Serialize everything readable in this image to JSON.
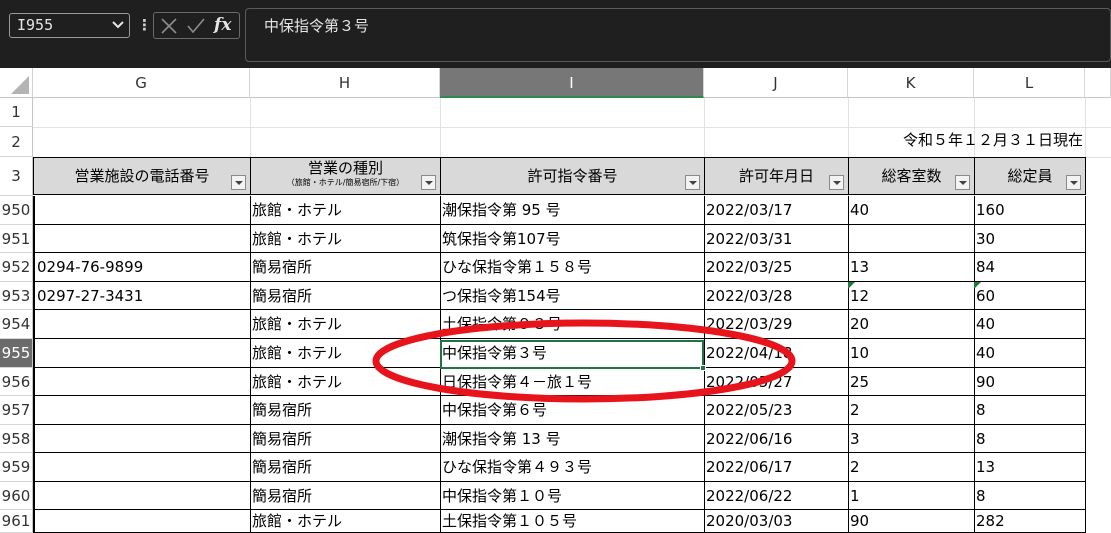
{
  "formula_bar": {
    "name_box": "I955",
    "fx_label": "fx",
    "formula": "中保指令第３号"
  },
  "columns": [
    "G",
    "H",
    "I",
    "J",
    "K",
    "L"
  ],
  "row_numbers": [
    "1",
    "2",
    "3",
    "950",
    "951",
    "952",
    "953",
    "954",
    "955",
    "956",
    "957",
    "958",
    "959",
    "960",
    "961"
  ],
  "date_note": "令和５年１２月３１日現在",
  "headers": {
    "phone": "営業施設の電話番号",
    "type": "営業の種別",
    "type_sub": "（旅館・ホテル/簡易宿所/下宿）",
    "permit_no": "許可指令番号",
    "permit_date": "許可年月日",
    "rooms": "総客室数",
    "capacity": "総定員"
  },
  "rows": [
    {
      "phone": "",
      "type": "旅館・ホテル",
      "permit": "潮保指令第 95 号",
      "date": "2022/03/17",
      "rooms": "40",
      "cap": "160"
    },
    {
      "phone": "",
      "type": "旅館・ホテル",
      "permit": "筑保指令第107号",
      "date": "2022/03/31",
      "rooms": "",
      "cap": "30"
    },
    {
      "phone": "0294-76-9899",
      "type": "簡易宿所",
      "permit": "ひな保指令第１５８号",
      "date": "2022/03/25",
      "rooms": "13",
      "cap": "84"
    },
    {
      "phone": "0297-27-3431",
      "type": "簡易宿所",
      "permit": "つ保指令第154号",
      "date": "2022/03/28",
      "rooms": "12",
      "cap": "60"
    },
    {
      "phone": "",
      "type": "旅館・ホテル",
      "permit": "土保指令第９３号",
      "date": "2022/03/29",
      "rooms": "20",
      "cap": "40"
    },
    {
      "phone": "",
      "type": "旅館・ホテル",
      "permit": "中保指令第３号",
      "date": "2022/04/18",
      "rooms": "10",
      "cap": "40"
    },
    {
      "phone": "",
      "type": "旅館・ホテル",
      "permit": "日保指令第４－旅１号",
      "date": "2022/05/27",
      "rooms": "25",
      "cap": "90"
    },
    {
      "phone": "",
      "type": "簡易宿所",
      "permit": "中保指令第６号",
      "date": "2022/05/23",
      "rooms": "2",
      "cap": "8"
    },
    {
      "phone": "",
      "type": "簡易宿所",
      "permit": "潮保指令第 13 号",
      "date": "2022/06/16",
      "rooms": "3",
      "cap": "8"
    },
    {
      "phone": "",
      "type": "簡易宿所",
      "permit": "ひな保指令第４９３号",
      "date": "2022/06/17",
      "rooms": "2",
      "cap": "13"
    },
    {
      "phone": "",
      "type": "簡易宿所",
      "permit": "中保指令第１０号",
      "date": "2022/06/22",
      "rooms": "1",
      "cap": "8"
    },
    {
      "phone": "",
      "type": "旅館・ホテル",
      "permit": "土保指令第１０５号",
      "date": "2020/03/03",
      "rooms": "90",
      "cap": "282"
    }
  ],
  "colors": {
    "ribbon_dark": "#1f1f1f",
    "selection_green": "#217346",
    "header_fill": "#d9d9d9",
    "annotation_red": "#e8141c"
  }
}
